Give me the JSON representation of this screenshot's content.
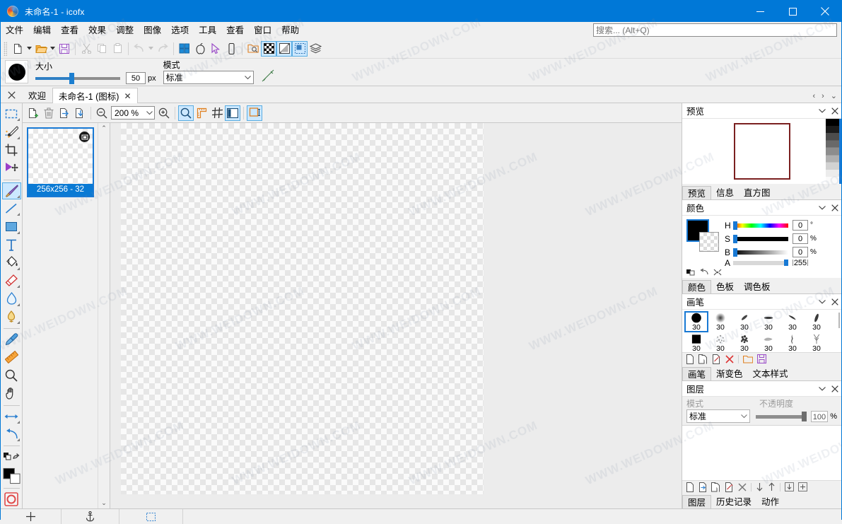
{
  "window": {
    "title": "未命名-1 - icofx",
    "logo_icon": "app-logo-icon",
    "minimize_label": "—",
    "maximize_label": "□",
    "close_label": "✕"
  },
  "menubar": {
    "items": [
      {
        "label": "文件"
      },
      {
        "label": "编辑"
      },
      {
        "label": "查看"
      },
      {
        "label": "效果"
      },
      {
        "label": "调整"
      },
      {
        "label": "图像"
      },
      {
        "label": "选项"
      },
      {
        "label": "工具"
      },
      {
        "label": "查看"
      },
      {
        "label": "窗口"
      },
      {
        "label": "帮助"
      }
    ],
    "search": {
      "value": "",
      "placeholder": "搜索... (Alt+Q)"
    }
  },
  "toolbar": {
    "buttons": [
      {
        "name": "new-document-icon",
        "active": false
      },
      {
        "name": "open-folder-icon",
        "active": false
      },
      {
        "name": "save-icon",
        "active": false
      },
      {
        "name": "cut-icon",
        "active": false
      },
      {
        "name": "copy-icon",
        "active": false
      },
      {
        "name": "paste-icon",
        "active": false
      },
      {
        "name": "undo-icon",
        "active": false
      },
      {
        "name": "redo-icon",
        "active": false
      },
      {
        "name": "windows-icon",
        "active": false
      },
      {
        "name": "apple-icon",
        "active": false
      },
      {
        "name": "cursor-icon",
        "active": false
      },
      {
        "name": "mobile-icon",
        "active": false
      },
      {
        "name": "extract-icon",
        "active": false
      },
      {
        "name": "transparency-checker-icon",
        "active": true
      },
      {
        "name": "no-alpha-icon",
        "active": true
      },
      {
        "name": "selection-overlay-icon",
        "active": true
      },
      {
        "name": "layers-stack-icon",
        "active": false
      }
    ]
  },
  "options_bar": {
    "size_label": "大小",
    "size_value": "50",
    "size_unit": "px",
    "mode_label": "模式",
    "mode_value": "标准",
    "brush_color": "#000000",
    "pressure_icon": "pressure-pen-icon"
  },
  "tabbar": {
    "close_all_icon": "close-icon",
    "tabs": [
      {
        "label": "欢迎",
        "active": false,
        "closable": false
      },
      {
        "label": "未命名-1 (图标)",
        "active": true,
        "closable": true,
        "close_label": "✕"
      }
    ],
    "nav_prev": "‹",
    "nav_next": "›",
    "nav_list": "⌄"
  },
  "tools": {
    "groups": [
      {
        "items": [
          {
            "name": "rectangle-select-tool",
            "active": false,
            "has_submenu": true
          },
          {
            "name": "magic-wand-tool",
            "active": false,
            "has_submenu": true
          },
          {
            "name": "crop-tool",
            "active": false,
            "has_submenu": false
          },
          {
            "name": "move-selection-tool",
            "active": false,
            "has_submenu": false
          }
        ]
      },
      {
        "items": [
          {
            "name": "paintbrush-tool",
            "active": true,
            "has_submenu": true
          },
          {
            "name": "line-tool",
            "active": false,
            "has_submenu": true
          },
          {
            "name": "rectangle-shape-tool",
            "active": false,
            "has_submenu": true
          },
          {
            "name": "text-tool",
            "active": false,
            "has_submenu": false
          },
          {
            "name": "paint-bucket-tool",
            "active": false,
            "has_submenu": true
          },
          {
            "name": "eraser-tool",
            "active": false,
            "has_submenu": true
          },
          {
            "name": "blur-tool",
            "active": false,
            "has_submenu": true
          },
          {
            "name": "dodge-burn-tool",
            "active": false,
            "has_submenu": true
          }
        ]
      },
      {
        "items": [
          {
            "name": "eyedropper-tool",
            "active": false,
            "has_submenu": false
          },
          {
            "name": "measure-tool",
            "active": false,
            "has_submenu": false
          },
          {
            "name": "zoom-tool",
            "active": false,
            "has_submenu": false
          },
          {
            "name": "hand-tool",
            "active": false,
            "has_submenu": false
          }
        ]
      },
      {
        "items": [
          {
            "name": "horizontal-flip-tool",
            "active": false,
            "has_submenu": true
          },
          {
            "name": "rotate-tool",
            "active": false,
            "has_submenu": true
          }
        ]
      },
      {
        "items": [
          {
            "name": "swap-colors-icon",
            "active": false,
            "has_submenu": false
          },
          {
            "name": "foreground-background-color-icon",
            "active": false,
            "has_submenu": false
          }
        ]
      },
      {
        "items": [
          {
            "name": "record-macro-icon",
            "active": false,
            "has_submenu": false
          }
        ]
      }
    ]
  },
  "doc_toolbar": {
    "buttons": [
      {
        "name": "new-frame-icon",
        "active": false
      },
      {
        "name": "delete-frame-icon",
        "active": false
      },
      {
        "name": "import-frame-icon",
        "active": false
      },
      {
        "name": "export-frame-icon",
        "active": false
      },
      {
        "name": "zoom-out-icon",
        "active": false
      },
      {
        "name": "zoom-in-icon",
        "active": false
      },
      {
        "name": "magnifier-icon",
        "active": true
      },
      {
        "name": "ruler-icon",
        "active": false
      },
      {
        "name": "grid-icon",
        "active": false
      },
      {
        "name": "panel-toggle-icon",
        "active": true
      },
      {
        "name": "fit-window-icon",
        "active": true
      }
    ],
    "zoom_value": "200 %"
  },
  "frames": {
    "items": [
      {
        "label": "256x256 - 32",
        "selected": true,
        "badge_icon": "image-badge-icon"
      }
    ],
    "scroll_up": "⌃",
    "scroll_down": "⌄"
  },
  "dock": {
    "preview_panel": {
      "title": "预览",
      "collapse_icon": "chevron-down-icon",
      "close_icon": "close-icon",
      "tabs": [
        {
          "label": "预览",
          "active": true
        },
        {
          "label": "信息",
          "active": false
        },
        {
          "label": "直方图",
          "active": false
        }
      ],
      "frame_border_color": "#7b2020"
    },
    "color_panel": {
      "title": "颜色",
      "collapse_icon": "chevron-down-icon",
      "close_icon": "close-icon",
      "foreground": "#000000",
      "channels": [
        {
          "label": "H",
          "value": "0",
          "unit": "°"
        },
        {
          "label": "S",
          "value": "0",
          "unit": "%"
        },
        {
          "label": "B",
          "value": "0",
          "unit": "%"
        },
        {
          "label": "A",
          "value": "255",
          "unit": ""
        }
      ],
      "mini_icons": [
        "color-model-icon",
        "reset-color-icon",
        "sample-color-icon"
      ],
      "tabs": [
        {
          "label": "颜色",
          "active": true
        },
        {
          "label": "色板",
          "active": false
        },
        {
          "label": "调色板",
          "active": false
        }
      ]
    },
    "brush_panel": {
      "title": "画笔",
      "collapse_icon": "chevron-down-icon",
      "close_icon": "close-icon",
      "brushes_row1": [
        {
          "size": "30",
          "shape": "round-hard",
          "selected": true
        },
        {
          "size": "30",
          "shape": "round-soft",
          "selected": false
        },
        {
          "size": "30",
          "shape": "slanted-small",
          "selected": false
        },
        {
          "size": "30",
          "shape": "flat-oval",
          "selected": false
        },
        {
          "size": "30",
          "shape": "comet",
          "selected": false
        },
        {
          "size": "30",
          "shape": "teardrop",
          "selected": false
        }
      ],
      "brushes_row2": [
        {
          "size": "30",
          "shape": "square-hard",
          "selected": false
        },
        {
          "size": "30",
          "shape": "spatter-light",
          "selected": false
        },
        {
          "size": "30",
          "shape": "spatter-dense",
          "selected": false
        },
        {
          "size": "30",
          "shape": "leaf",
          "selected": false
        },
        {
          "size": "30",
          "shape": "smoke",
          "selected": false
        },
        {
          "size": "30",
          "shape": "grass",
          "selected": false
        }
      ],
      "action_icons": [
        "new-brush-icon",
        "duplicate-brush-icon",
        "edit-brush-icon",
        "delete-brush-icon",
        "open-brush-folder-icon",
        "save-brush-icon"
      ],
      "tabs": [
        {
          "label": "画笔",
          "active": true
        },
        {
          "label": "渐变色",
          "active": false
        },
        {
          "label": "文本样式",
          "active": false
        }
      ]
    },
    "layer_panel": {
      "title": "图层",
      "collapse_icon": "chevron-down-icon",
      "close_icon": "close-icon",
      "mode_label": "模式",
      "mode_value": "标准",
      "opacity_label": "不透明度",
      "opacity_value": "100",
      "opacity_unit": "%",
      "layers": [],
      "action_icons": [
        "new-layer-icon",
        "import-layer-icon",
        "duplicate-layer-icon",
        "layer-properties-icon",
        "delete-layer-icon",
        "move-down-icon",
        "move-up-icon",
        "merge-down-icon",
        "flatten-icon"
      ],
      "tabs": [
        {
          "label": "图层",
          "active": true
        },
        {
          "label": "历史记录",
          "active": false
        },
        {
          "label": "动作",
          "active": false
        }
      ]
    }
  },
  "statusbar": {
    "cells": [
      {
        "name": "cursor-position-icon",
        "label": ""
      },
      {
        "name": "anchor-icon",
        "label": ""
      },
      {
        "name": "selection-icon",
        "label": ""
      },
      {
        "name": "status-message",
        "label": ""
      }
    ]
  },
  "watermarks": [
    "WWW.WEIDOWN.COM",
    "WWW.WEIDOWN.COM",
    "WWW.WEIDOWN.COM",
    "WWW.WEIDOWN.COM",
    "WWW.WEIDOWN.COM",
    "WWW.WEIDOWN.COM",
    "WWW.WEIDOWN.COM",
    "WWW.WEIDOWN.COM",
    "WWW.WEIDOWN.COM",
    "WWW.WEIDOWN.COM",
    "WWW.WEIDOWN.COM",
    "WWW.WEIDOWN.COM",
    "WWW.WEIDOWN.COM",
    "WWW.WEIDOWN.COM",
    "WWW.WEIDOWN.COM",
    "WWW.WEIDOWN.COM",
    "WWW.WEIDOWN.COM",
    "WWW.WEIDOWN.COM",
    "WWW.WEIDOWN.COM",
    "WWW.WEIDOWN.COM"
  ],
  "colors": {
    "accent": "#0078d7",
    "titlebar": "#0078d7",
    "panel_bg": "#f0f0f0",
    "selection": "#cce8ff"
  }
}
